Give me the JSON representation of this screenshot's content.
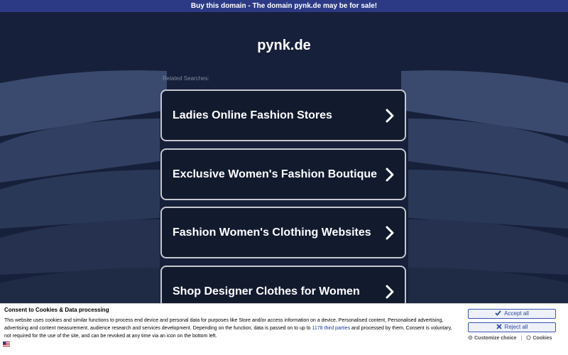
{
  "topbar": {
    "text": "Buy this domain - The domain pynk.de may be for sale!"
  },
  "site": {
    "title": "pynk.de"
  },
  "related": {
    "label": "Related Searches:"
  },
  "cards": [
    {
      "label": "Ladies Online Fashion Stores",
      "icon": "chevron-right-icon"
    },
    {
      "label": "Exclusive Women's Fashion Boutique",
      "icon": "chevron-right-icon"
    },
    {
      "label": "Fashion Women's Clothing Websites",
      "icon": "chevron-right-icon"
    },
    {
      "label": "Shop Designer Clothes for Women",
      "icon": "chevron-right-icon"
    }
  ],
  "consent": {
    "title": "Consent to Cookies & Data processing",
    "text_1": "This website uses cookies and similar functions to process end device and personal data for purposes like Store and/or access information on a device, Personalised content, Personalised advertising, advertising and content measurement, audience research and services development. Depending on the function, data is passed on to up to ",
    "link_text": "1178 third parties",
    "text_2": " and processed by them. Consent is voluntary, not required for the use of the site, and can be revoked at any time via an icon on the bottom left.",
    "accept_label": "Accept all",
    "reject_label": "Reject all",
    "customize_label": "Customize choice",
    "separator": "|",
    "cookies_label": "Cookies",
    "language_icon": "us-flag-icon"
  },
  "colors": {
    "background": "#17203a",
    "topbar": "#2c3a85",
    "card_border": "#c5c8cf",
    "button_accent": "#2a4aa8"
  }
}
